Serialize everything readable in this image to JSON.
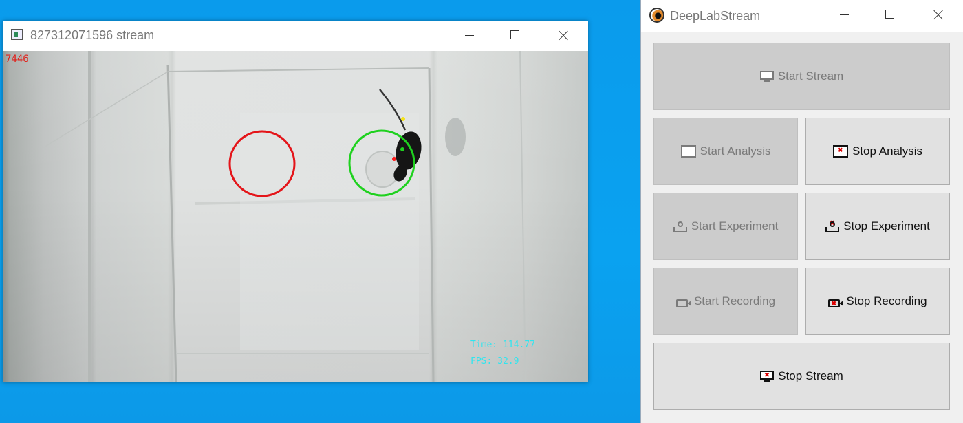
{
  "stream_window": {
    "title": "827312071596 stream",
    "frame_number": "7446",
    "time_text": "Time: 114.77",
    "fps_text": "FPS: 32.9"
  },
  "dls_window": {
    "title": "DeepLabStream",
    "buttons": {
      "start_stream": {
        "label": "Start Stream",
        "icon": "monitor-icon",
        "enabled": false
      },
      "start_analysis": {
        "label": "Start Analysis",
        "icon": "chart-icon",
        "enabled": false
      },
      "stop_analysis": {
        "label": "Stop Analysis",
        "icon": "chart-stop-icon",
        "enabled": true
      },
      "start_experiment": {
        "label": "Start Experiment",
        "icon": "experiment-icon",
        "enabled": false
      },
      "stop_experiment": {
        "label": "Stop Experiment",
        "icon": "experiment-stop-icon",
        "enabled": true
      },
      "start_recording": {
        "label": "Start Recording",
        "icon": "camera-icon",
        "enabled": false
      },
      "stop_recording": {
        "label": "Stop Recording",
        "icon": "camera-stop-icon",
        "enabled": true
      },
      "stop_stream": {
        "label": "Stop Stream",
        "icon": "monitor-stop-icon",
        "enabled": true
      }
    }
  },
  "colors": {
    "desktop": "#0aa2f0",
    "roi_inactive": "#e4151a",
    "roi_active": "#1fd11f",
    "frame_counter": "#e0201a",
    "overlay_text": "#2fe5ef",
    "keypoint_nose": "#f5e31a",
    "keypoint_neck": "#1fd11f",
    "keypoint_tail": "#ff1a1a"
  }
}
